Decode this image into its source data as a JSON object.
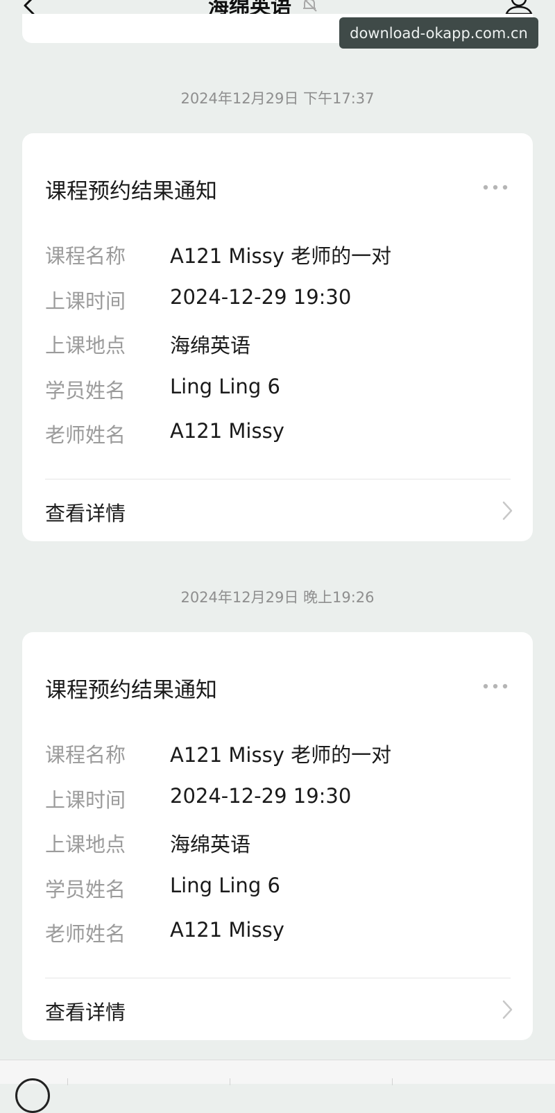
{
  "nav": {
    "title": "海绵英语"
  },
  "watermark": "download-okapp.com.cn",
  "messages": [
    {
      "timestamp": "2024年12月29日 下午17:37",
      "title": "课程预约结果通知",
      "fields": [
        {
          "label": "课程名称",
          "value": "A121 Missy 老师的一对"
        },
        {
          "label": "上课时间",
          "value": "2024-12-29 19:30"
        },
        {
          "label": "上课地点",
          "value": "海绵英语"
        },
        {
          "label": "学员姓名",
          "value": "Ling Ling 6"
        },
        {
          "label": "老师姓名",
          "value": "A121 Missy"
        }
      ],
      "footer_label": "查看详情"
    },
    {
      "timestamp": "2024年12月29日 晚上19:26",
      "title": "课程预约结果通知",
      "fields": [
        {
          "label": "课程名称",
          "value": "A121 Missy 老师的一对"
        },
        {
          "label": "上课时间",
          "value": "2024-12-29 19:30"
        },
        {
          "label": "上课地点",
          "value": "海绵英语"
        },
        {
          "label": "学员姓名",
          "value": "Ling Ling 6"
        },
        {
          "label": "老师姓名",
          "value": "A121 Missy"
        }
      ],
      "footer_label": "查看详情"
    }
  ],
  "icons": {
    "back": "back-arrow-icon",
    "mute": "bell-muted-icon",
    "profile": "profile-icon",
    "more": "more-dots-icon",
    "chevron": "chevron-right-icon",
    "keyboard": "keyboard-toggle-icon"
  },
  "colors": {
    "background": "#ebefed",
    "card": "#ffffff",
    "label_gray": "#9b9b9b",
    "timestamp_gray": "#8e8e8e",
    "watermark_bg": "#3f4a48"
  }
}
